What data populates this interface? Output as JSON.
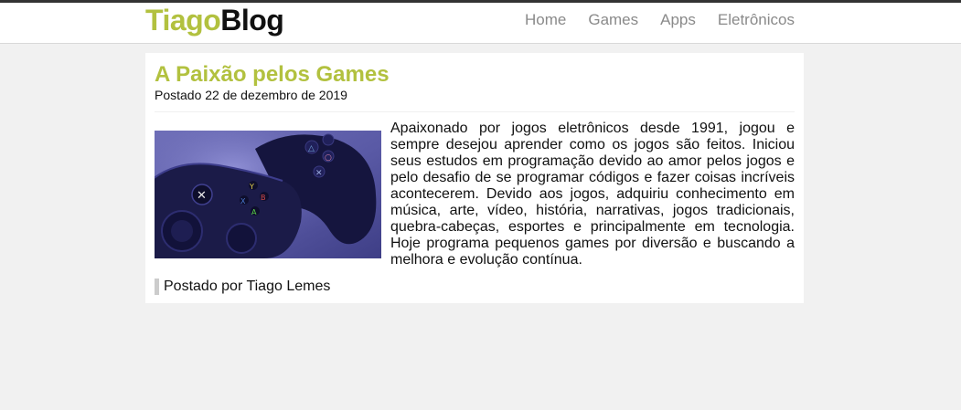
{
  "brand": {
    "part1": "Tiago",
    "part2": "Blog"
  },
  "nav": [
    {
      "label": "Home"
    },
    {
      "label": "Games"
    },
    {
      "label": "Apps"
    },
    {
      "label": "Eletrônicos"
    }
  ],
  "post": {
    "title": "A Paixão pelos Games",
    "date": "Postado 22 de dezembro de 2019",
    "body": "Apaixonado por jogos eletrônicos desde 1991, jogou e sempre desejou aprender como os jogos são feitos. Iniciou seus estudos em programação devido ao amor pelos jogos e pelo desafio de se programar códigos e fazer coisas incríveis acontecerem. Devido aos jogos, adquiriu conhecimento em música, arte, vídeo, história, narrativas, jogos tradicionais, quebra-cabeças, esportes e principalmente em tecnologia. Hoje programa pequenos games por diversão e buscando a melhora e evolução contínua.",
    "author": "Postado por Tiago Lemes",
    "image_subject": "xbox-and-playstation-controllers"
  },
  "colors": {
    "accent": "#b2c13f",
    "page_bg": "#f1f1f1",
    "nav_text": "#8a8a8a"
  }
}
